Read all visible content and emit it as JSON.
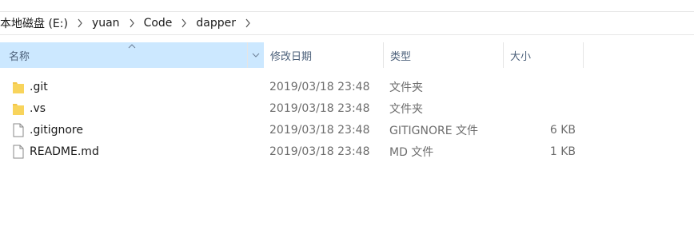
{
  "breadcrumb": {
    "items": [
      "本地磁盘 (E:)",
      "yuan",
      "Code",
      "dapper"
    ]
  },
  "columns": {
    "name": "名称",
    "modified": "修改日期",
    "type": "类型",
    "size": "大小"
  },
  "files": [
    {
      "name": ".git",
      "modified": "2019/03/18 23:48",
      "type": "文件夹",
      "size": "",
      "icon": "folder-icon"
    },
    {
      "name": ".vs",
      "modified": "2019/03/18 23:48",
      "type": "文件夹",
      "size": "",
      "icon": "folder-icon"
    },
    {
      "name": ".gitignore",
      "modified": "2019/03/18 23:48",
      "type": "GITIGNORE 文件",
      "size": "6 KB",
      "icon": "file-icon"
    },
    {
      "name": "README.md",
      "modified": "2019/03/18 23:48",
      "type": "MD 文件",
      "size": "1 KB",
      "icon": "file-icon"
    }
  ],
  "colors": {
    "sorted_header_bg": "#cce8ff",
    "folder": "#f3c64a",
    "header_text": "#4c607a"
  }
}
